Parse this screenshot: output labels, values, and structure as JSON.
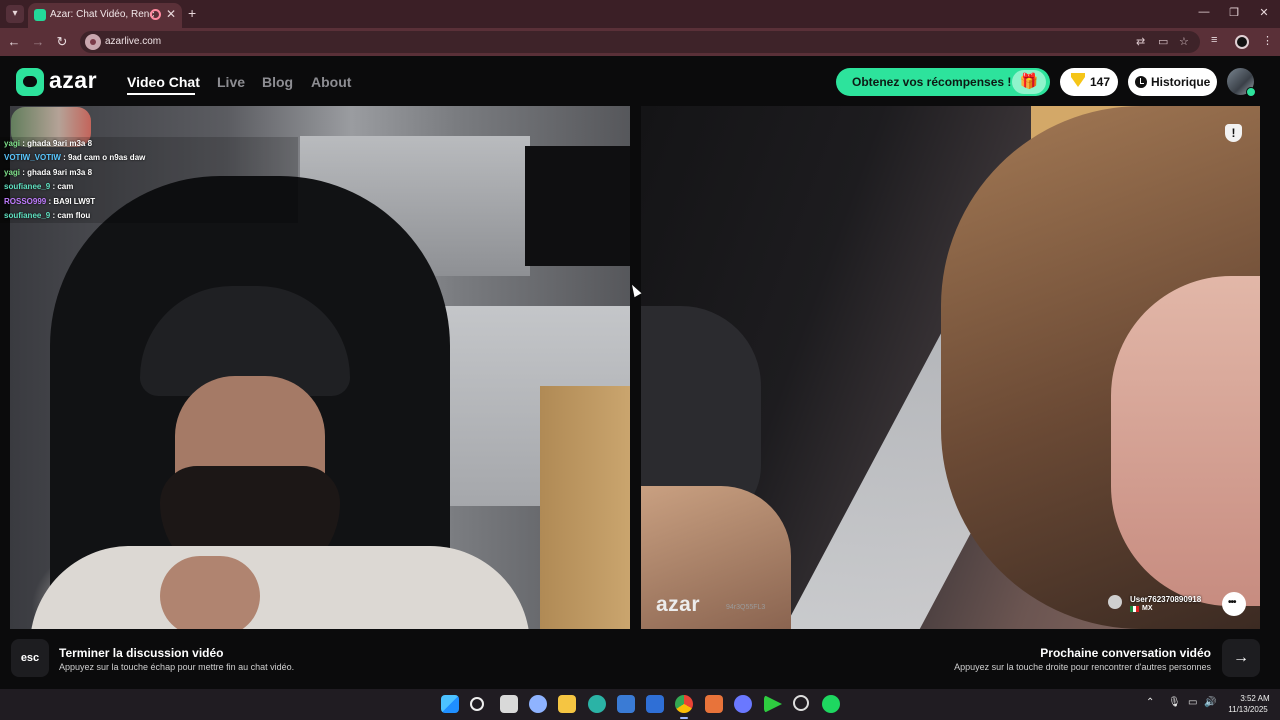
{
  "browser": {
    "tab_title": "Azar: Chat Vidéo, Rencontres",
    "url": "azarlive.com",
    "tab_close": "✕",
    "new_tab": "+",
    "win_minimize": "—",
    "win_restore": "❐",
    "win_close": "✕",
    "back": "←",
    "forward": "→",
    "reload": "↻"
  },
  "header": {
    "logo_text": "azar",
    "nav": [
      {
        "label": "Video Chat",
        "active": true
      },
      {
        "label": "Live"
      },
      {
        "label": "Blog"
      },
      {
        "label": "About"
      }
    ],
    "rewards_label": "Obtenez vos récompenses !",
    "gems_count": "147",
    "history_label": "Historique"
  },
  "chat_messages": [
    {
      "user": "yagi",
      "message": " : ghada 9ari m3a 8",
      "color": "#7fe08a"
    },
    {
      "user": "VOTIW_VOTIW",
      "message": " : 9ad cam o n9as daw",
      "color": "#5ac8ff"
    },
    {
      "user": "yagi",
      "message": " : ghada 9ari m3a 8",
      "color": "#7fe08a"
    },
    {
      "user": "soufianee_9",
      "message": " : cam",
      "color": "#5fe0c0"
    },
    {
      "user": "ROSSO999",
      "message": " : BA9I LW9T",
      "color": "#c07cff"
    },
    {
      "user": "soufianee_9",
      "message": " : cam flou",
      "color": "#5fe0c0"
    }
  ],
  "partner": {
    "watermark_logo": "azar",
    "watermark_id": "94r3Q55FL3",
    "username": "User762370890918",
    "country": "MX",
    "report_icon": "!"
  },
  "controls": {
    "esc_key": "esc",
    "end_title": "Terminer la discussion vidéo",
    "end_sub": "Appuyez sur la touche échap pour mettre fin au chat vidéo.",
    "next_title": "Prochaine conversation vidéo",
    "next_sub": "Appuyez sur la touche droite pour rencontrer d'autres personnes",
    "next_arrow": "→"
  },
  "taskbar": {
    "time": "3:52 AM",
    "date": "11/13/2025"
  },
  "colors": {
    "accent": "#2de39c",
    "browser_frame": "#3b1f26"
  }
}
